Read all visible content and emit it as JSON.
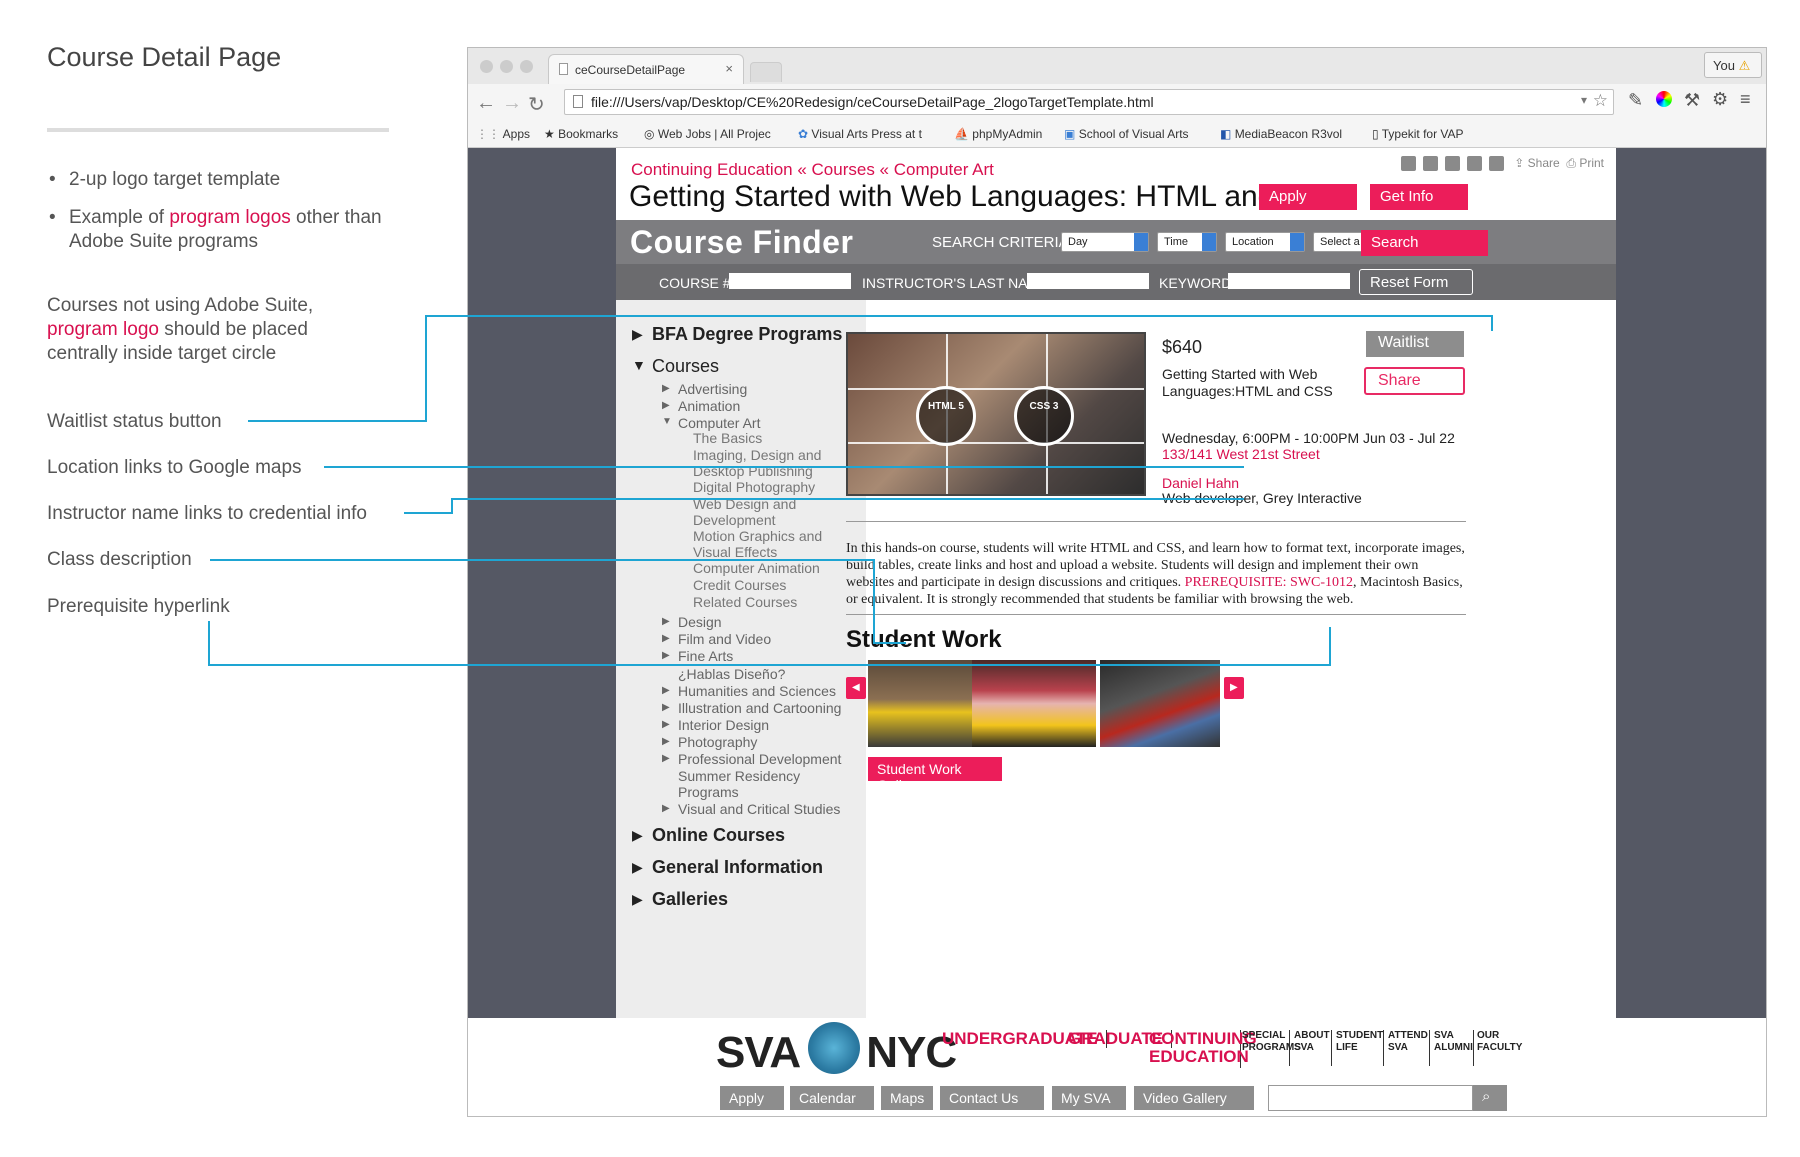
{
  "annotations": {
    "title": "Course Detail Page",
    "bullets": [
      {
        "text": "2-up logo target template"
      },
      {
        "pre": "Example of ",
        "link": "program logos",
        "post": " other than Adobe Suite programs"
      }
    ],
    "note_pre": "Courses not using Adobe Suite,",
    "note_link": "program logo",
    "note_post": " should be placed centrally inside target circle",
    "callouts": [
      "Waitlist status button",
      "Location links to Google maps",
      "Instructor name links to credential info",
      "Class description",
      "Prerequisite hyperlink"
    ],
    "line_color": "#1ea5d3"
  },
  "browser": {
    "tab_title": "ceCourseDetailPage",
    "tab_close": "×",
    "profile": "You",
    "url": "file:///Users/vap/Desktop/CE%20Redesign/ceCourseDetailPage_2logoTargetTemplate.html",
    "bookmarks": [
      "Apps",
      "Bookmarks",
      "Web Jobs | All Projec",
      "Visual Arts Press at t",
      "phpMyAdmin",
      "School of Visual Arts",
      "MediaBeacon R3vol",
      "Typekit for VAP"
    ]
  },
  "page": {
    "breadcrumb": "Continuing Education « Courses « Computer Art",
    "course_title": "Getting Started with Web Languages: HTML and CSS",
    "share_label": "Share",
    "print_label": "Print",
    "apply_label": "Apply",
    "getinfo_label": "Get Info",
    "finder": {
      "title": "Course Finder",
      "criteria_label": "SEARCH CRITERIA",
      "selects": [
        "Day",
        "Time",
        "Location",
        "Select a program"
      ],
      "search_label": "Search",
      "course_label": "COURSE #",
      "instructor_label": "INSTRUCTOR'S LAST NAME",
      "keyword_label": "KEYWORD",
      "reset_label": "Reset Form"
    },
    "sidebar": {
      "top": [
        "BFA Degree Programs",
        "Courses",
        "Online Courses",
        "General Information",
        "Galleries"
      ],
      "courses": [
        "Advertising",
        "Animation",
        "Computer Art",
        "Design",
        "Film and Video",
        "Fine Arts",
        "¿Hablas Diseño?",
        "Humanities and Sciences",
        "Illustration and Cartooning",
        "Interior Design",
        "Photography",
        "Professional Development",
        "Summer Residency Programs",
        "Visual and Critical Studies"
      ],
      "computer_art": [
        "The Basics",
        "Imaging, Design and Desktop Publishing",
        "Digital Photography",
        "Web Design and Development",
        "Motion Graphics and Visual Effects",
        "Computer Animation",
        "Credit Courses",
        "Related Courses"
      ]
    },
    "detail": {
      "logo1": "HTML 5",
      "logo2": "CSS 3",
      "price": "$640",
      "waitlist_label": "Waitlist",
      "share_btn": "Share",
      "course_name": "Getting Started with Web Languages:HTML and CSS",
      "schedule": "Wednesday, 6:00PM - 10:00PM Jun 03 - Jul 22",
      "location": "133/141 West 21st Street",
      "instructor": "Daniel Hahn",
      "instructor_title": "Web developer, Grey Interactive",
      "desc_pre": "In this hands-on course, students will write HTML and CSS, and learn how to format text, incorporate images, build tables, create links and host and upload a website. Students will design and implement their own websites and participate in design discussions and critiques. ",
      "desc_link": "PREREQUISITE: SWC-1012",
      "desc_post": ", Macintosh Basics, or equivalent. It is strongly recommended that students be familiar with browsing the web."
    },
    "student_work": {
      "title": "Student Work",
      "gallery_label": "Student Work Gallery"
    }
  },
  "footer": {
    "logo_left": "SVA",
    "logo_right": "NYC",
    "nav": [
      "UNDERGRADUATE",
      "GRADUATE",
      "CONTINUING EDUCATION"
    ],
    "small_nav": [
      "SPECIAL PROGRAMS",
      "ABOUT SVA",
      "STUDENT LIFE",
      "ATTEND SVA",
      "SVA ALUMNI",
      "OUR FACULTY"
    ],
    "buttons": [
      "Apply",
      "Calendar",
      "Maps",
      "Contact Us",
      "My SVA",
      "Video Gallery"
    ]
  },
  "colors": {
    "accent": "#ec1d5a",
    "link": "#d8104f",
    "gray_button": "#8d8d8d",
    "finder_bar": "#7d7d80"
  }
}
